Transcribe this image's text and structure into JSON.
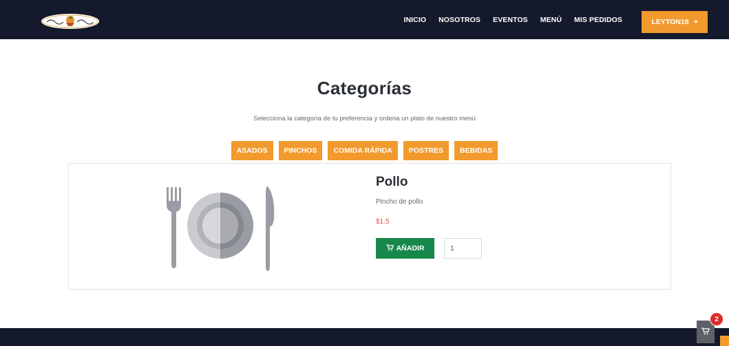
{
  "navbar": {
    "links": [
      "INICIO",
      "NOSOTROS",
      "EVENTOS",
      "MENÚ",
      "MIS PEDIDOS"
    ],
    "user_label": "LEYTON18"
  },
  "page": {
    "title": "Categorías",
    "subtitle": "Selecciona la categoría de tu preferencia y ordena un plato de nuestro menú"
  },
  "categories": [
    "ASADOS",
    "PINCHOS",
    "COMIDA RÁPIDA",
    "POSTRES",
    "BEBIDAS"
  ],
  "product": {
    "name": "Pollo",
    "description": "Pincho de pollo",
    "price": "$1.5",
    "add_label": "AÑADIR",
    "quantity": "1"
  },
  "cart": {
    "count": "2"
  },
  "colors": {
    "navbar": "#141a2b",
    "accent": "#f29a2e",
    "add_button": "#17884a",
    "price": "#e2505c"
  }
}
